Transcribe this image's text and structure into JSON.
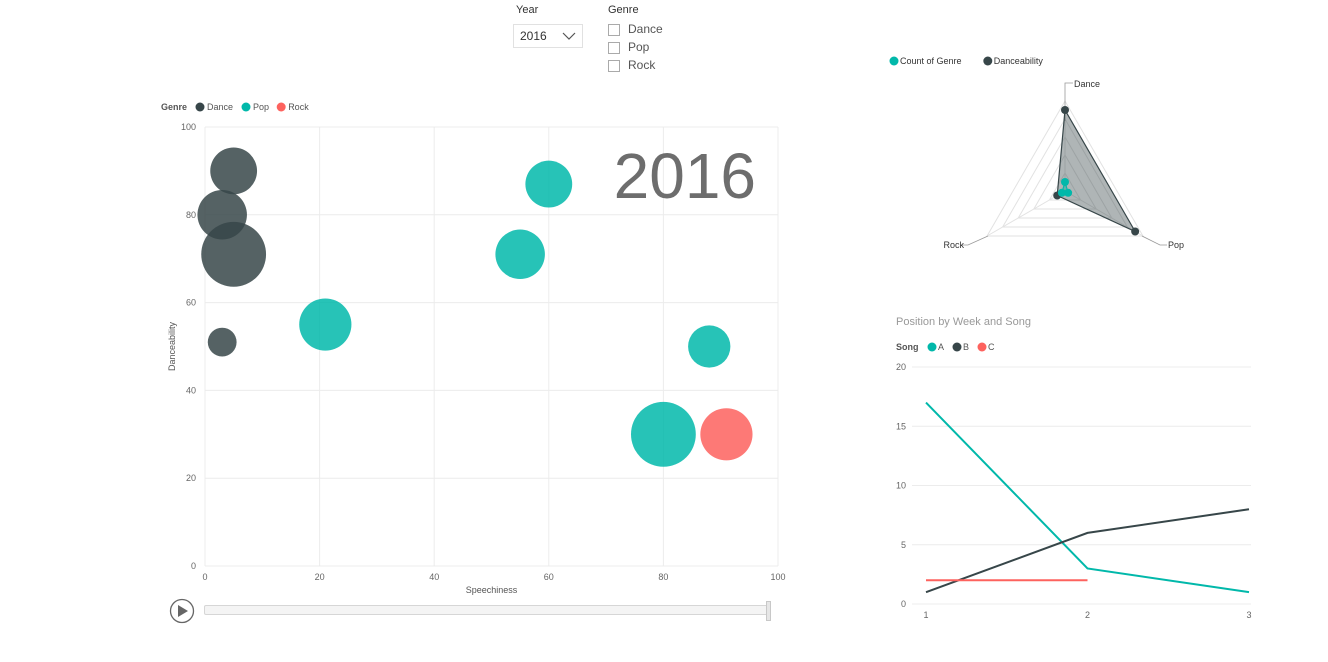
{
  "slicers": {
    "year": {
      "title": "Year",
      "selected": "2016"
    },
    "genre": {
      "title": "Genre",
      "options": [
        "Dance",
        "Pop",
        "Rock"
      ]
    }
  },
  "colors": {
    "dance": "#374649",
    "pop": "#01b8aa",
    "rock": "#fd625e"
  },
  "icons": {
    "dropdown": "chevron-down-icon",
    "play": "play-icon"
  },
  "play_axis": {
    "current": "2016",
    "position_fraction": 1.0
  },
  "chart_data": [
    {
      "type": "scatter",
      "title": "",
      "xlabel": "Speechiness",
      "ylabel": "Danceability",
      "xlim": [
        0,
        100
      ],
      "ylim": [
        0,
        100
      ],
      "x_ticks": [
        0,
        20,
        40,
        60,
        80,
        100
      ],
      "y_ticks": [
        0,
        20,
        40,
        60,
        80,
        100
      ],
      "legend_title": "Genre",
      "legend_position": "top-left",
      "grid": true,
      "watermark": "2016",
      "series": [
        {
          "name": "Dance",
          "color": "#374649",
          "points": [
            {
              "x": 5,
              "y": 90,
              "size": 0.52
            },
            {
              "x": 3,
              "y": 80,
              "size": 0.55
            },
            {
              "x": 5,
              "y": 71,
              "size": 0.72
            },
            {
              "x": 3,
              "y": 51,
              "size": 0.32
            }
          ]
        },
        {
          "name": "Pop",
          "color": "#01b8aa",
          "points": [
            {
              "x": 60,
              "y": 87,
              "size": 0.52
            },
            {
              "x": 55,
              "y": 71,
              "size": 0.55
            },
            {
              "x": 21,
              "y": 55,
              "size": 0.58
            },
            {
              "x": 88,
              "y": 50,
              "size": 0.47
            },
            {
              "x": 80,
              "y": 30,
              "size": 0.72
            }
          ]
        },
        {
          "name": "Rock",
          "color": "#fd625e",
          "points": [
            {
              "x": 91,
              "y": 30,
              "size": 0.58
            }
          ]
        }
      ]
    },
    {
      "type": "radar",
      "categories": [
        "Dance",
        "Pop",
        "Rock"
      ],
      "legend_position": "top-left",
      "max_value": 1,
      "series": [
        {
          "name": "Count of Genre",
          "color": "#01b8aa",
          "values": [
            0.1,
            0.04,
            0.04
          ]
        },
        {
          "name": "Danceability",
          "color": "#374649",
          "values": [
            0.9,
            0.9,
            0.1
          ]
        }
      ]
    },
    {
      "type": "line",
      "title": "Position by Week and Song",
      "legend_title": "Song",
      "legend_position": "top-left",
      "x": [
        1,
        2,
        3
      ],
      "ylim": [
        0,
        20
      ],
      "y_ticks": [
        0,
        5,
        10,
        15,
        20
      ],
      "grid": true,
      "series": [
        {
          "name": "A",
          "color": "#01b8aa",
          "values": [
            17,
            3,
            1
          ]
        },
        {
          "name": "B",
          "color": "#374649",
          "values": [
            1,
            6,
            8
          ]
        },
        {
          "name": "C",
          "color": "#fd625e",
          "values": [
            2,
            2,
            null
          ]
        }
      ]
    }
  ]
}
